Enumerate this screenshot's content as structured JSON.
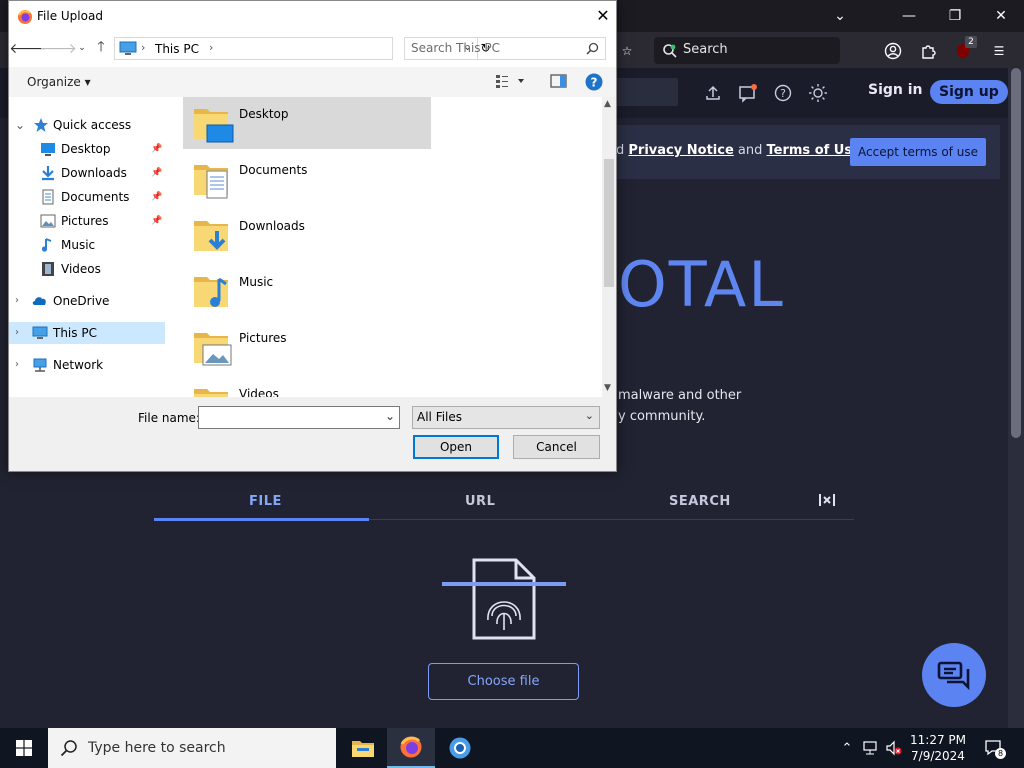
{
  "browser": {
    "search_label": "Search",
    "extension_badge": "2",
    "colors": {
      "frame": "#1c1b22",
      "toolbar": "#2b2a33"
    }
  },
  "vt": {
    "sign_in": "Sign in",
    "sign_up": "Sign up",
    "banner_conn": "d",
    "banner_link1": "Privacy Notice",
    "banner_and": "and",
    "banner_link2": "Terms of Use",
    "banner_end": ".",
    "accept": "Accept terms of use",
    "logo_fragment": "OTAL",
    "desc_line1": "malware and other",
    "desc_line2": "y community.",
    "tabs": [
      "FILE",
      "URL",
      "SEARCH"
    ],
    "choose_file": "Choose file",
    "accent": "#5b83f2"
  },
  "dialog": {
    "title": "File Upload",
    "address": "This PC",
    "search_placeholder": "Search This PC",
    "organize": "Organize ▾",
    "nav": {
      "quick_access": "Quick access",
      "desktop": "Desktop",
      "downloads": "Downloads",
      "documents": "Documents",
      "pictures": "Pictures",
      "music": "Music",
      "videos": "Videos",
      "onedrive": "OneDrive",
      "this_pc": "This PC",
      "network": "Network"
    },
    "files": [
      "Desktop",
      "Documents",
      "Downloads",
      "Music",
      "Pictures",
      "Videos"
    ],
    "file_name_label": "File name:",
    "file_name_value": "",
    "file_type": "All Files",
    "open": "Open",
    "cancel": "Cancel"
  },
  "taskbar": {
    "search_placeholder": "Type here to search",
    "time": "11:27 PM",
    "date": "7/9/2024",
    "notifications": "8"
  }
}
